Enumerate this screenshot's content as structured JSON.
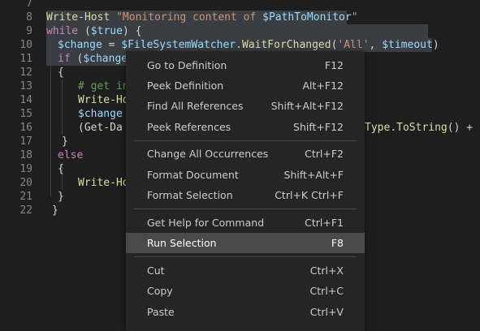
{
  "editor": {
    "line_numbers": [
      "7",
      "8",
      "9",
      "10",
      "11",
      "12",
      "13",
      "14",
      "15",
      "16",
      "17",
      "18",
      "19",
      "20",
      "21",
      "22"
    ],
    "lines": {
      "l8": {
        "a": "Write-Host",
        "b": " ",
        "c": "\"Monitoring content of ",
        "d": "$PathToMonitor",
        "e": "\""
      },
      "l9": {
        "a": "while",
        "b": " (",
        "c": "$true",
        "d": ") {"
      },
      "l10": {
        "a": "$change",
        "b": " = ",
        "c": "$FileSystemWatcher",
        "d": ".",
        "e": "WaitForChanged",
        "f": "(",
        "g": "'All'",
        "h": ", ",
        "i": "$timeout",
        "j": ")"
      },
      "l11": {
        "a": "if",
        "b": " (",
        "c": "$change"
      },
      "l12": {
        "a": "{"
      },
      "l13": {
        "a": "# get in"
      },
      "l14": {
        "a": "Write-Ho"
      },
      "l15": {
        "a": "$change"
      },
      "l16": {
        "a": "(Get-Da",
        "b": "Type",
        "c": ".",
        "d": "ToString",
        "e": "() + ",
        "f": "\","
      },
      "l17": {
        "a": "}"
      },
      "l18": {
        "a": "else"
      },
      "l19": {
        "a": "{"
      },
      "l20": {
        "a": "Write-Ho"
      },
      "l21": {
        "a": "}"
      },
      "l22": {
        "a": "}"
      }
    }
  },
  "context_menu": {
    "items": [
      {
        "label": "Go to Definition",
        "shortcut": "F12"
      },
      {
        "label": "Peek Definition",
        "shortcut": "Alt+F12"
      },
      {
        "label": "Find All References",
        "shortcut": "Shift+Alt+F12"
      },
      {
        "label": "Peek References",
        "shortcut": "Shift+F12"
      },
      {
        "label": "Change All Occurrences",
        "shortcut": "Ctrl+F2"
      },
      {
        "label": "Format Document",
        "shortcut": "Shift+Alt+F"
      },
      {
        "label": "Format Selection",
        "shortcut": "Ctrl+K Ctrl+F"
      },
      {
        "label": "Get Help for Command",
        "shortcut": "Ctrl+F1"
      },
      {
        "label": "Run Selection",
        "shortcut": "F8"
      },
      {
        "label": "Cut",
        "shortcut": "Ctrl+X"
      },
      {
        "label": "Copy",
        "shortcut": "Ctrl+C"
      },
      {
        "label": "Paste",
        "shortcut": "Ctrl+V"
      }
    ],
    "active_item": "Run Selection"
  },
  "colors": {
    "background": "#1e1e1e",
    "menu_background": "#252526",
    "menu_active": "#4a4a4a",
    "selection": "#3a3d41"
  }
}
